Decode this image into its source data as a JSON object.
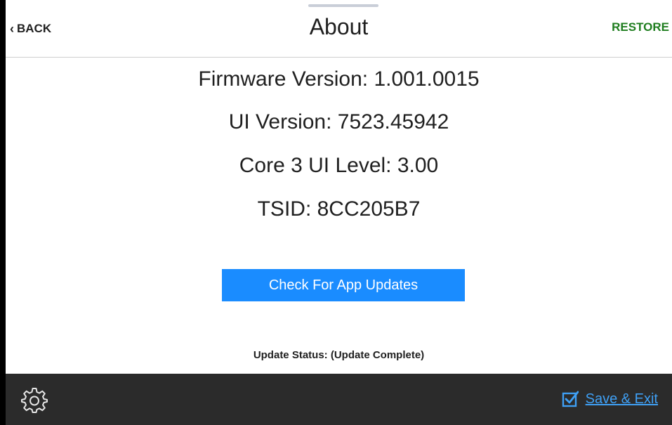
{
  "header": {
    "back_label": "BACK",
    "back_icon": "chevron-left-icon",
    "title": "About",
    "restore_label": "RESTORE"
  },
  "info": {
    "firmware": "Firmware Version: 1.001.0015",
    "ui_version": "UI Version: 7523.45942",
    "core_level": "Core 3 UI Level: 3.00",
    "tsid": "TSID: 8CC205B7"
  },
  "actions": {
    "check_updates_label": "Check For App Updates"
  },
  "status": {
    "text": "Update Status: (Update Complete)"
  },
  "footer": {
    "settings_icon": "gear-icon",
    "save_exit_icon": "checkbox-checked-icon",
    "save_exit_label": "Save & Exit"
  },
  "colors": {
    "accent_blue": "#1a8cff",
    "restore_green": "#1e7d1e",
    "footer_bg": "#2b2b2b",
    "link_blue": "#3fa0f5"
  }
}
